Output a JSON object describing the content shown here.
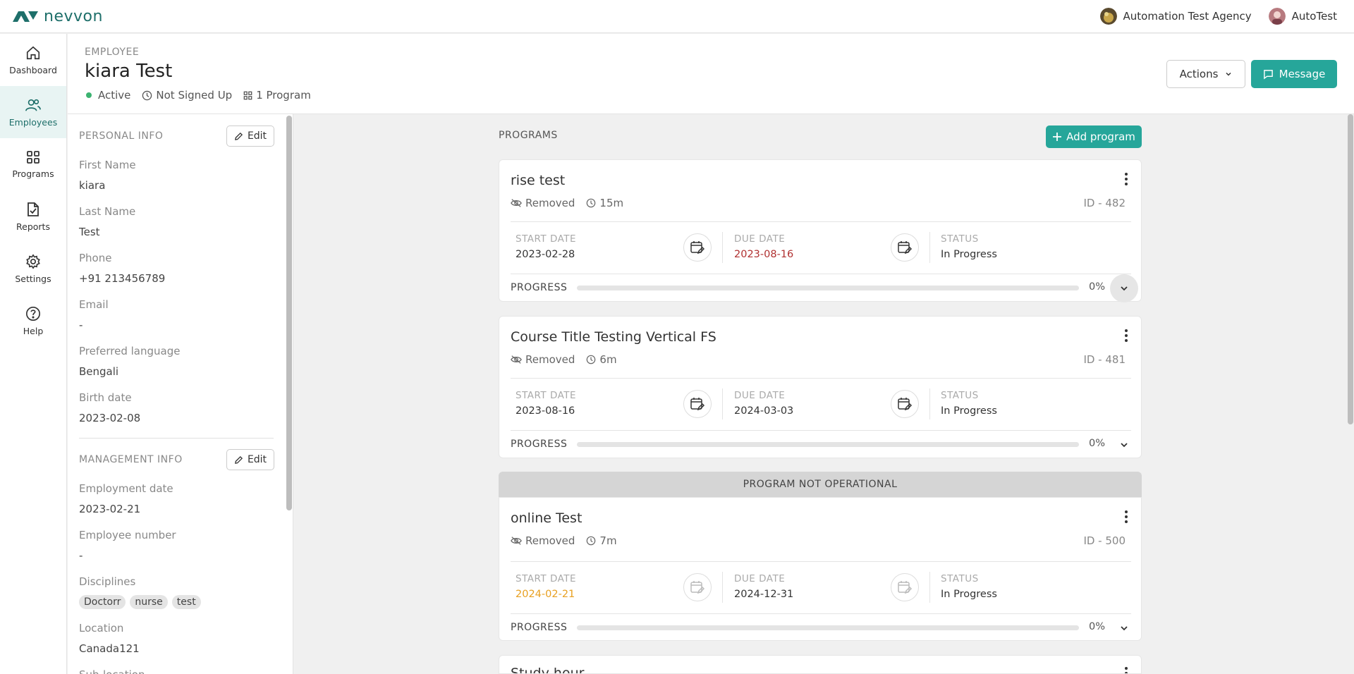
{
  "app": {
    "brand": "nevvon",
    "agency": "Automation Test Agency",
    "user": "AutoTest"
  },
  "nav": {
    "items": [
      {
        "label": "Dashboard",
        "icon": "home-icon"
      },
      {
        "label": "Employees",
        "icon": "users-icon",
        "active": true
      },
      {
        "label": "Programs",
        "icon": "grid-icon"
      },
      {
        "label": "Reports",
        "icon": "report-icon"
      },
      {
        "label": "Settings",
        "icon": "gear-icon"
      },
      {
        "label": "Help",
        "icon": "help-icon"
      }
    ]
  },
  "header": {
    "eyebrow": "EMPLOYEE",
    "name": "kiara Test",
    "status": "Active",
    "signup": "Not Signed Up",
    "programs_count": "1 Program",
    "actions_label": "Actions",
    "message_label": "Message"
  },
  "personal": {
    "title": "PERSONAL INFO",
    "edit_label": "Edit",
    "fields": [
      {
        "label": "First Name",
        "value": "kiara"
      },
      {
        "label": "Last Name",
        "value": "Test"
      },
      {
        "label": "Phone",
        "value": "+91 213456789"
      },
      {
        "label": "Email",
        "value": "-"
      },
      {
        "label": "Preferred language",
        "value": "Bengali"
      },
      {
        "label": "Birth date",
        "value": "2023-02-08"
      }
    ]
  },
  "management": {
    "title": "MANAGEMENT INFO",
    "edit_label": "Edit",
    "employment_date_label": "Employment date",
    "employment_date": "2023-02-21",
    "employee_number_label": "Employee number",
    "employee_number": "-",
    "disciplines_label": "Disciplines",
    "disciplines": [
      "Doctorr",
      "nurse",
      "test"
    ],
    "location_label": "Location",
    "location": "Canada121",
    "sublocation_label": "Sub-location"
  },
  "programs": {
    "title": "PROGRAMS",
    "add_label": "Add program",
    "not_operational_banner": "PROGRAM NOT OPERATIONAL",
    "labels": {
      "start": "START DATE",
      "due": "DUE DATE",
      "status": "STATUS",
      "progress": "PROGRESS"
    },
    "items": [
      {
        "title": "rise test",
        "visibility": "Removed",
        "duration": "15m",
        "id": "ID - 482",
        "start": "2023-02-28",
        "due": "2023-08-16",
        "status": "In Progress",
        "progress": "0%",
        "progress_value": 0
      },
      {
        "title": "Course Title Testing Vertical FS",
        "visibility": "Removed",
        "duration": "6m",
        "id": "ID - 481",
        "start": "2023-08-16",
        "due": "2024-03-03",
        "status": "In Progress",
        "progress": "0%",
        "progress_value": 0
      },
      {
        "title": "online Test",
        "visibility": "Removed",
        "duration": "7m",
        "id": "ID - 500",
        "start": "2024-02-21",
        "due": "2024-12-31",
        "status": "In Progress",
        "progress": "0%",
        "progress_value": 0
      },
      {
        "title": "Study hour"
      }
    ]
  },
  "colors": {
    "brand": "#1e6f6a",
    "accent": "#26a69a",
    "overdue": "#b03030",
    "warning": "#e8a020"
  }
}
